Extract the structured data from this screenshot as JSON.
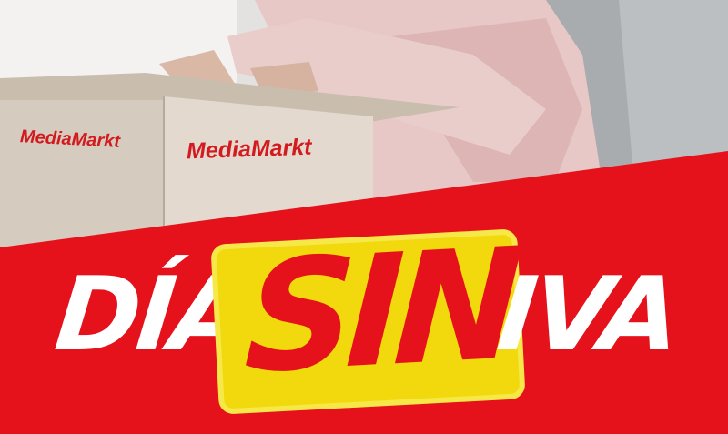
{
  "banner": {
    "word_left": "DÍA",
    "word_highlight": "SIN",
    "word_right": "IVA"
  },
  "box_logos": {
    "left": "MediaMarkt",
    "right": "MediaMarkt"
  },
  "colors": {
    "brand_red": "#e5121b",
    "highlight_yellow": "#f2d90e",
    "text_white": "#ffffff"
  }
}
